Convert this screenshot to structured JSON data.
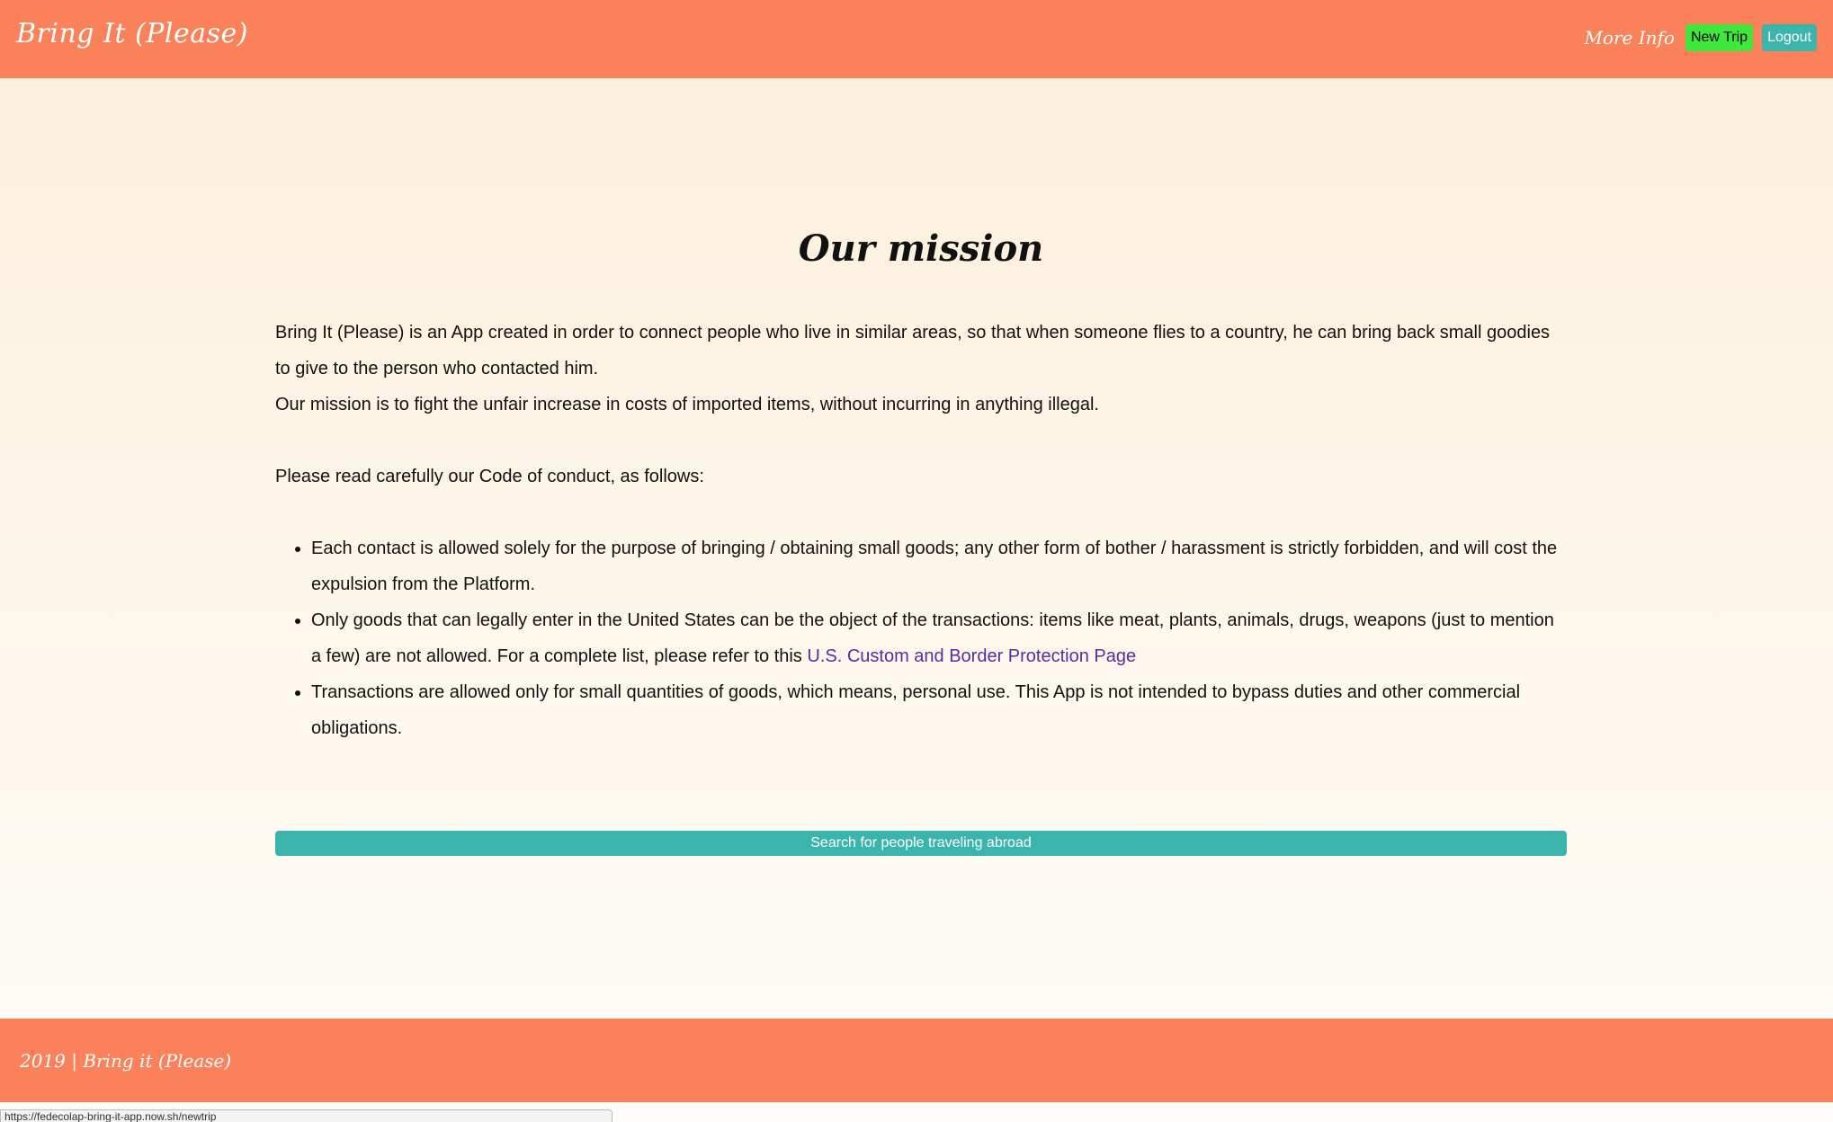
{
  "header": {
    "brand": "Bring It (Please)",
    "more_info": "More Info",
    "new_trip": "New Trip",
    "logout": "Logout"
  },
  "main": {
    "title": "Our mission",
    "intro_1": "Bring It (Please) is an App created in order to connect people who live in similar areas, so that when someone flies to a country, he can bring back small goodies to give to the person who contacted him.",
    "intro_2": "Our mission is to fight the unfair increase in costs of imported items, without incurring in anything illegal.",
    "code_intro": "Please read carefully our Code of conduct, as follows:",
    "rules": [
      "Each contact is allowed solely for the purpose of bringing / obtaining small goods; any other form of bother / harassment is strictly forbidden, and will cost the expulsion from the Platform.",
      "Only goods that can legally enter in the United States can be the object of the transactions: items like meat, plants, animals, drugs, weapons (just to mention a few) are not allowed. For a complete list, please refer to this ",
      "Transactions are allowed only for small quantities of goods, which means, personal use. This App is not intended to bypass duties and other commercial obligations."
    ],
    "cbp_link": "U.S. Custom and Border Protection Page",
    "search_button": "Search for people traveling abroad"
  },
  "footer": {
    "text": "2019 | Bring it (Please)"
  },
  "status_bar": {
    "url": "https://fedecolap-bring-it-app.now.sh/newtrip"
  },
  "colors": {
    "header_bg": "#fa8159",
    "accent_teal": "#3bb4ac",
    "new_trip_green": "#3fe83a",
    "link_purple": "#5a2ca0"
  }
}
